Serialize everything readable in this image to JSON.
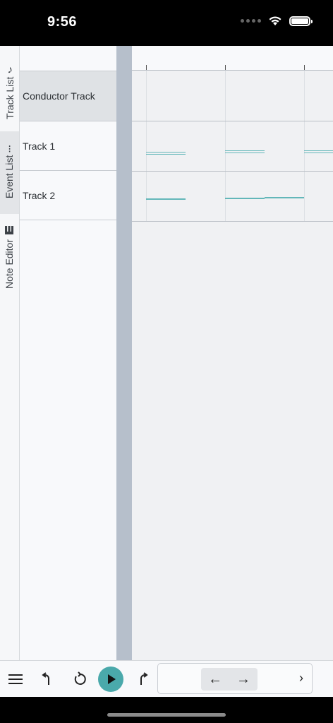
{
  "status_bar": {
    "time": "9:56",
    "wifi_icon": "wifi-icon",
    "battery_icon": "battery-icon"
  },
  "side_tabs": [
    {
      "label": "Track List",
      "icon": "music-note-icon",
      "active": false
    },
    {
      "label": "Event List",
      "icon": "list-icon",
      "active": true
    },
    {
      "label": "Note Editor",
      "icon": "piano-keys-icon",
      "active": false
    }
  ],
  "tracks": [
    {
      "name": "Conductor Track",
      "selected": true
    },
    {
      "name": "Track 1",
      "selected": false
    },
    {
      "name": "Track 2",
      "selected": false
    }
  ],
  "colors": {
    "accent": "#4aa9ab",
    "note": "#63b7b9",
    "splitter": "#b6bfcb"
  },
  "toolbar": {
    "menu_icon": "menu-icon",
    "undo_icon": "undo-icon",
    "loop_icon": "loop-icon",
    "play_icon": "play-icon",
    "redo_icon": "redo-icon",
    "prev_icon": "arrow-left-icon",
    "next_icon": "arrow-right-icon",
    "more_icon": "chevron-right-icon"
  }
}
